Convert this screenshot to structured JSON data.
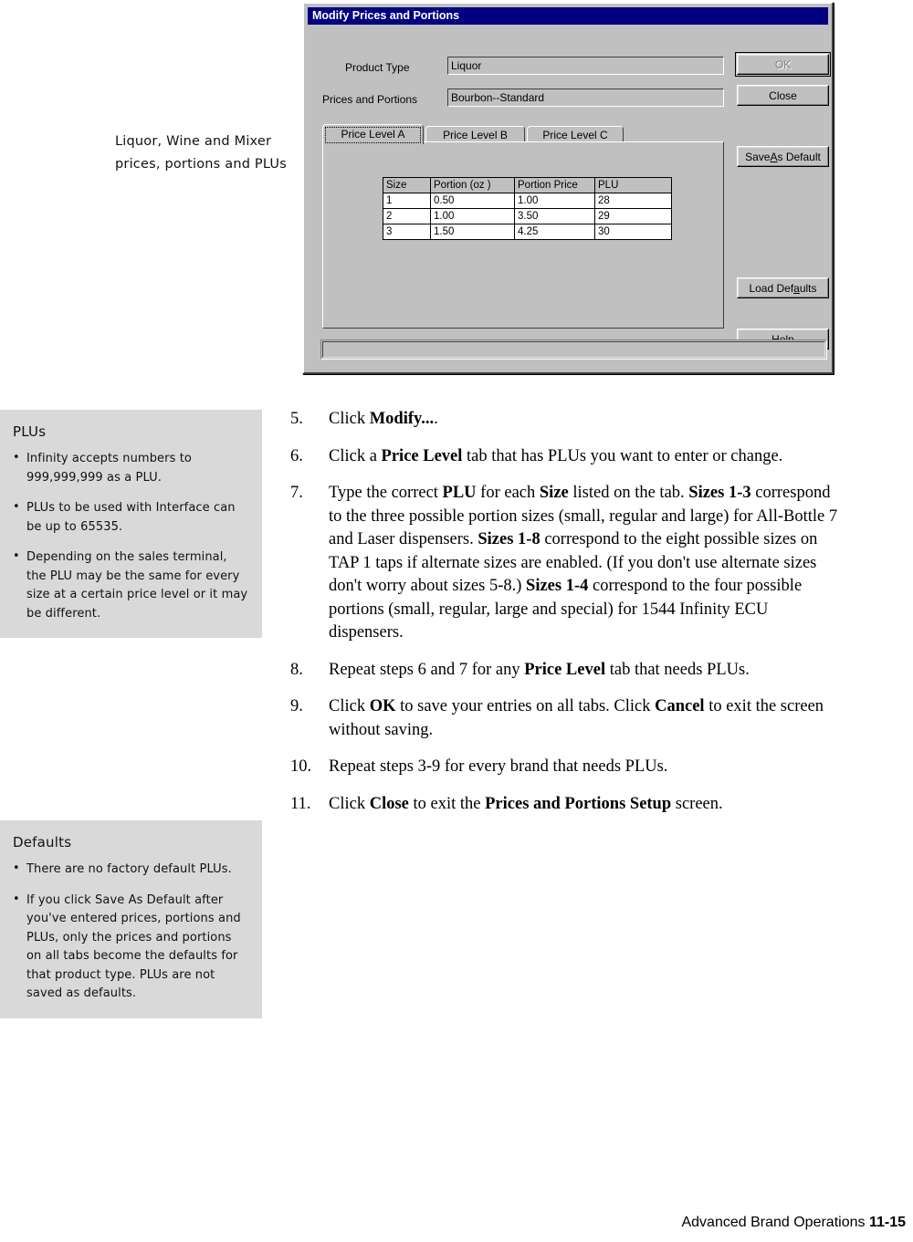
{
  "margin_note": "Liquor, Wine and Mixer prices, portions and PLUs",
  "dialog": {
    "title": "Modify Prices and Portions",
    "fields": {
      "product_type_label": "Product Type",
      "product_type_value": "Liquor",
      "prices_portions_label": "Prices and Portions",
      "prices_portions_value": "Bourbon--Standard"
    },
    "buttons": {
      "ok": "OK",
      "close": "Close",
      "save_as_default_pre": "Save ",
      "save_as_default_accel": "A",
      "save_as_default_post": "s Default",
      "load_defaults_pre": "Load Def",
      "load_defaults_accel": "a",
      "load_defaults_post": "ults",
      "help": "Help"
    },
    "tabs": [
      {
        "label": "Price Level A",
        "active": true
      },
      {
        "label": "Price Level B",
        "active": false
      },
      {
        "label": "Price Level C",
        "active": false
      }
    ],
    "grid": {
      "headers": [
        "Size",
        "Portion (oz  )",
        "Portion Price",
        "PLU"
      ],
      "rows": [
        [
          "1",
          "0.50",
          "1.00",
          "28"
        ],
        [
          "2",
          "1.00",
          "3.50",
          "29"
        ],
        [
          "3",
          "1.50",
          "4.25",
          "30"
        ]
      ]
    },
    "statusbar_text": "",
    "colors": {
      "titlebar": "#000080",
      "face": "#c0c0c0",
      "shadow": "#808080",
      "highlight": "#ffffff"
    }
  },
  "sidebar_notes": [
    {
      "title": "PLUs",
      "items": [
        "Infinity accepts numbers to 999,999,999 as a PLU.",
        "PLUs to be used with Interface can be up to 65535.",
        "Depending on the sales terminal, the PLU may be the same for every size at a certain price level or it may be different."
      ]
    },
    {
      "title": "Defaults",
      "items": [
        "There are no factory default PLUs.",
        "If you click Save As Default after you've entered prices, portions and PLUs, only the prices and portions on all tabs become the defaults for that product type. PLUs are not saved as defaults."
      ]
    }
  ],
  "steps": [
    {
      "num": "5.",
      "html": "Click <b>Modify...</b>."
    },
    {
      "num": "6.",
      "html": "Click a <b>Price Level</b> tab that has PLUs you want to enter or change."
    },
    {
      "num": "7.",
      "html": "Type the correct <b>PLU</b> for each <b>Size</b> listed on the tab. <b>Sizes 1-3</b> correspond to the three possible portion sizes (small, regular and large) for All-Bottle 7 and Laser dispensers. <b>Sizes 1-8</b> correspond to the eight possible sizes on TAP 1 taps if alternate sizes are enabled. (If you don't use alternate sizes don't worry about sizes 5-8.) <b>Sizes 1-4</b> correspond to the four possible portions (small, regular, large and special) for 1544 Infinity ECU dispensers."
    },
    {
      "num": "8.",
      "html": "Repeat steps 6 and 7 for any <b>Price Level</b> tab that needs PLUs."
    },
    {
      "num": "9.",
      "html": "Click <b>OK</b> to save your entries on all tabs. Click <b>Cancel</b> to exit the screen without saving."
    },
    {
      "num": "10.",
      "html": "Repeat steps 3-9 for every brand that needs PLUs."
    },
    {
      "num": "11.",
      "html": "Click <b>Close</b> to exit the <b>Prices and Portions Setup</b> screen."
    }
  ],
  "footer": {
    "chapter": "Advanced Brand Operations",
    "page": "11-15"
  }
}
